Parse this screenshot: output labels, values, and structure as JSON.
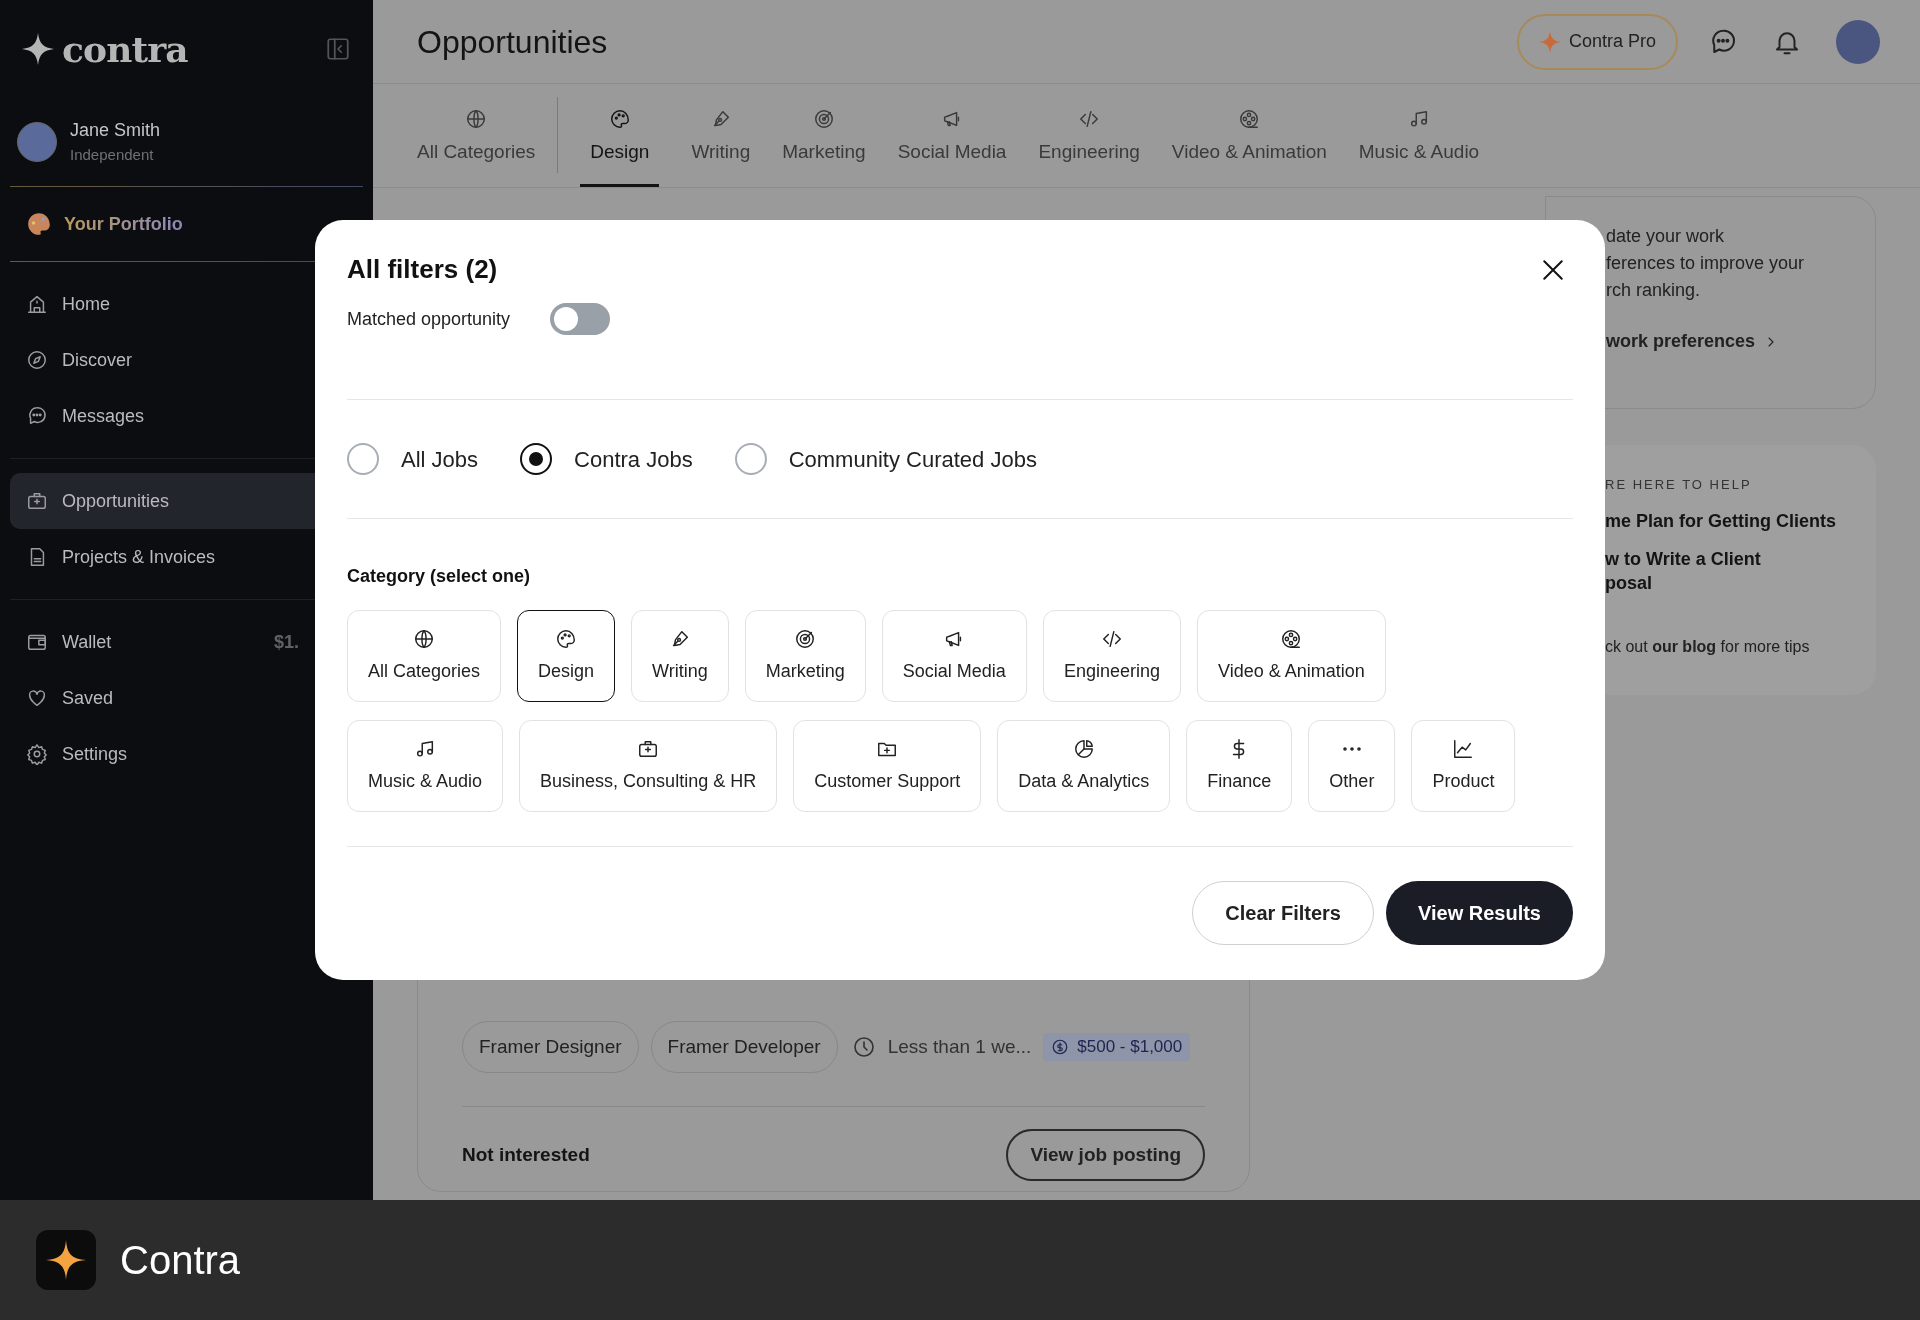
{
  "sidebar": {
    "brand": "contra",
    "user": {
      "name": "Jane Smith",
      "role": "Independent"
    },
    "portfolio": "Your Portfolio",
    "groups": [
      [
        {
          "label": "Home",
          "selected": false
        },
        {
          "label": "Discover",
          "selected": false
        },
        {
          "label": "Messages",
          "selected": false
        }
      ],
      [
        {
          "label": "Opportunities",
          "selected": true
        },
        {
          "label": "Projects & Invoices",
          "selected": false
        }
      ],
      [
        {
          "label": "Wallet",
          "selected": false,
          "value": "$1."
        },
        {
          "label": "Saved",
          "selected": false
        },
        {
          "label": "Settings",
          "selected": false
        }
      ]
    ]
  },
  "header": {
    "title": "Opportunities",
    "pro_button": "Contra Pro"
  },
  "tabs": [
    {
      "label": "All Categories",
      "selected": false
    },
    {
      "label": "Design",
      "selected": true
    },
    {
      "label": "Writing",
      "selected": false
    },
    {
      "label": "Marketing",
      "selected": false
    },
    {
      "label": "Social Media",
      "selected": false
    },
    {
      "label": "Engineering",
      "selected": false
    },
    {
      "label": "Video & Animation",
      "selected": false
    },
    {
      "label": "Music & Audio",
      "selected": false
    }
  ],
  "side_card": {
    "lines": [
      "date your work",
      "ferences to improve your",
      "rch ranking."
    ],
    "link": "work preferences"
  },
  "help_card": {
    "eyebrow": "RE HERE TO HELP",
    "articles": [
      "me Plan for Getting Clients",
      "w to Write a Client\nposal"
    ],
    "footer": "ck out **our blog** for more tips"
  },
  "job_card": {
    "tags": [
      "Framer Designer",
      "Framer Developer"
    ],
    "duration": "Less than 1 we...",
    "budget": "$500 - $1,000",
    "dismiss": "Not interested",
    "view_button": "View job posting"
  },
  "modal": {
    "title": "All filters (2)",
    "matched": {
      "label": "Matched opportunity",
      "on": false
    },
    "job_types": [
      {
        "label": "All Jobs",
        "selected": false
      },
      {
        "label": "Contra Jobs",
        "selected": true
      },
      {
        "label": "Community Curated Jobs",
        "selected": false
      }
    ],
    "category_heading": "Category (select one)",
    "categories": [
      {
        "label": "All Categories",
        "selected": false
      },
      {
        "label": "Design",
        "selected": true
      },
      {
        "label": "Writing",
        "selected": false
      },
      {
        "label": "Marketing",
        "selected": false
      },
      {
        "label": "Social Media",
        "selected": false
      },
      {
        "label": "Engineering",
        "selected": false
      },
      {
        "label": "Video & Animation",
        "selected": false
      },
      {
        "label": "Music & Audio",
        "selected": false
      },
      {
        "label": "Business, Consulting & HR",
        "selected": false
      },
      {
        "label": "Customer Support",
        "selected": false
      },
      {
        "label": "Data & Analytics",
        "selected": false
      },
      {
        "label": "Finance",
        "selected": false
      },
      {
        "label": "Other",
        "selected": false
      },
      {
        "label": "Product",
        "selected": false
      }
    ],
    "clear_button": "Clear Filters",
    "results_button": "View Results"
  },
  "app_bar": {
    "name": "Contra"
  }
}
